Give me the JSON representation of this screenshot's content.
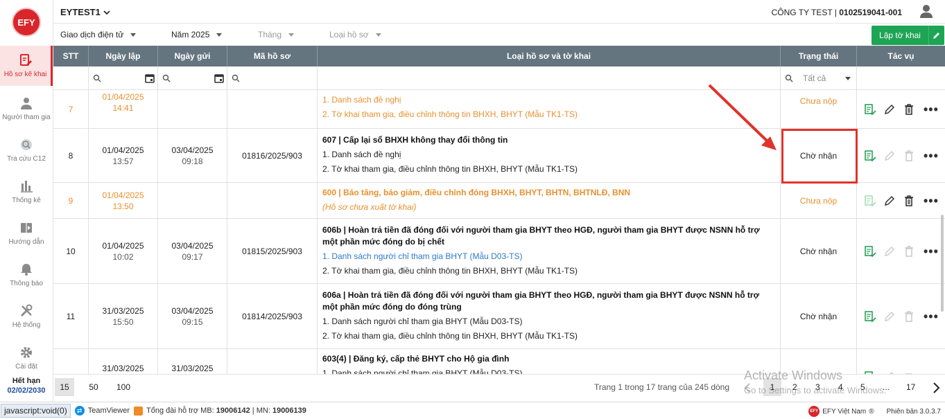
{
  "logo_text": "EFY",
  "sidebar": {
    "items": [
      {
        "label": "Hồ sơ kê khai",
        "icon": "file-edit-icon",
        "active": true
      },
      {
        "label": "Người tham gia",
        "icon": "person-icon"
      },
      {
        "label": "Tra cứu C12",
        "icon": "lookup-icon"
      },
      {
        "label": "Thống kê",
        "icon": "bar-chart-icon"
      },
      {
        "label": "Hướng dẫn",
        "icon": "video-book-icon"
      },
      {
        "label": "Thông báo",
        "icon": "bell-icon"
      },
      {
        "label": "Hệ thống",
        "icon": "tools-icon"
      },
      {
        "label": "Cài đặt",
        "icon": "gear-icon"
      }
    ],
    "expiry_label": "Hết hạn",
    "expiry_date": "02/02/2030"
  },
  "topbar": {
    "tax_code": "EYTEST1",
    "company_name": "CÔNG TY TEST | ",
    "company_tax": "0102519041-001"
  },
  "filters": {
    "transaction": "Giao dịch điện tử",
    "year": "Năm 2025",
    "month": "Tháng",
    "record_type": "Loại hồ sơ",
    "create_button": "Lập tờ khai"
  },
  "table": {
    "headers": [
      "STT",
      "Ngày lập",
      "Ngày gửi",
      "Mã hồ sơ",
      "Loại hồ sơ và tờ khai",
      "Trạng thái",
      "Tác vụ"
    ],
    "status_filter": "Tất cả",
    "rows": [
      {
        "stt": "7",
        "created_date": "01/04/2025",
        "created_time": "14:41",
        "sent_date": "",
        "sent_time": "",
        "code": "",
        "title": "",
        "lines": [
          "1. Danh sách đề nghị",
          "2. Tờ khai tham gia, điều chỉnh thông tin BHXH, BHYT (Mẫu TK1-TS)"
        ],
        "status": "Chưa nộp",
        "pending": true
      },
      {
        "stt": "8",
        "created_date": "01/04/2025",
        "created_time": "13:57",
        "sent_date": "03/04/2025",
        "sent_time": "09:18",
        "code": "01816/2025/903",
        "title": "607 | Cấp lại sổ BHXH không thay đổi thông tin",
        "lines": [
          "1. Danh sách đề nghị",
          "2. Tờ khai tham gia, điều chỉnh thông tin BHXH, BHYT (Mẫu TK1-TS)"
        ],
        "status": "Chờ nhận",
        "pending": false
      },
      {
        "stt": "9",
        "created_date": "01/04/2025",
        "created_time": "13:50",
        "sent_date": "",
        "sent_time": "",
        "code": "",
        "title": "600 | Báo tăng, báo giảm, điều chỉnh đóng BHXH, BHYT, BHTN, BHTNLĐ, BNN",
        "lines": [
          "(Hồ sơ chưa xuất tờ khai)"
        ],
        "status": "Chưa nộp",
        "pending": true
      },
      {
        "stt": "10",
        "created_date": "01/04/2025",
        "created_time": "10:02",
        "sent_date": "03/04/2025",
        "sent_time": "09:17",
        "code": "01815/2025/903",
        "title": "606b | Hoàn trả tiền đã đóng đối với người tham gia BHYT theo HGĐ, người tham gia BHYT được NSNN hỗ trợ một phần mức đóng do bị chết",
        "lines": [
          "1. Danh sách người chỉ tham gia BHYT (Mẫu D03-TS)",
          "2. Tờ khai tham gia, điều chỉnh thông tin BHXH, BHYT (Mẫu TK1-TS)"
        ],
        "status": "Chờ nhận",
        "pending": false
      },
      {
        "stt": "11",
        "created_date": "31/03/2025",
        "created_time": "15:50",
        "sent_date": "03/04/2025",
        "sent_time": "09:15",
        "code": "01814/2025/903",
        "title": "606a | Hoàn trả tiền đã đóng đối với người tham gia BHYT theo HGĐ, người tham gia BHYT được NSNN hỗ trợ một phần mức đóng do đóng trùng",
        "lines": [
          "1. Danh sách người chỉ tham gia BHYT (Mẫu D03-TS)",
          "2. Tờ khai tham gia, điều chỉnh thông tin BHXH, BHYT (Mẫu TK1-TS)"
        ],
        "status": "Chờ nhận",
        "pending": false
      },
      {
        "stt": "",
        "created_date": "31/03/2025",
        "created_time": "",
        "sent_date": "31/03/2025",
        "sent_time": "",
        "code": "",
        "title": "603(4) | Đăng ký, cấp thẻ BHYT cho Hộ gia đình",
        "lines": [
          "1. Danh sách người chỉ tham gia BHYT (Mẫu D03-TS)"
        ],
        "status": "",
        "pending": false
      }
    ]
  },
  "pager": {
    "sizes": [
      "15",
      "50",
      "100"
    ],
    "info": "Trang 1 trong 17 trang của 245 dòng",
    "pages": [
      "1",
      "2",
      "3",
      "4",
      "5",
      "...",
      "17"
    ]
  },
  "watermark": {
    "line1": "Activate Windows",
    "line2": "Go to Settings to activate Windows."
  },
  "statusbar": {
    "js": "javascript:void(0)",
    "teamviewer": "TeamViewer",
    "hotline_prefix": "Tổng đài hỗ trợ MB: ",
    "hotline_mb": "19006142",
    "hotline_sep": " | MN: ",
    "hotline_mn": "19006139",
    "brand": "EFY Việt Nam",
    "version": "Phiên bản 3.0.3.7"
  }
}
